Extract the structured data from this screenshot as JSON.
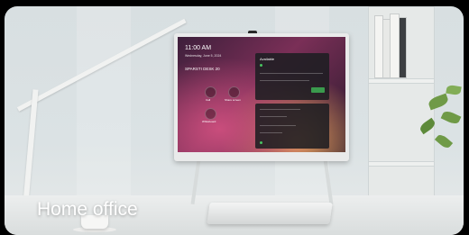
{
  "caption": "Home office",
  "screen": {
    "time": "11:00 AM",
    "date": "Wednesday, June 5, 2024",
    "room": "SPARSTI DESK 20",
    "actions": [
      "Call",
      "Share screen",
      "Whiteboard"
    ],
    "panel_title": "Available"
  },
  "colors": {
    "wallpaper": "#7a2f57",
    "accent_green": "#3a9a4d",
    "frame": "#e9eaea"
  }
}
